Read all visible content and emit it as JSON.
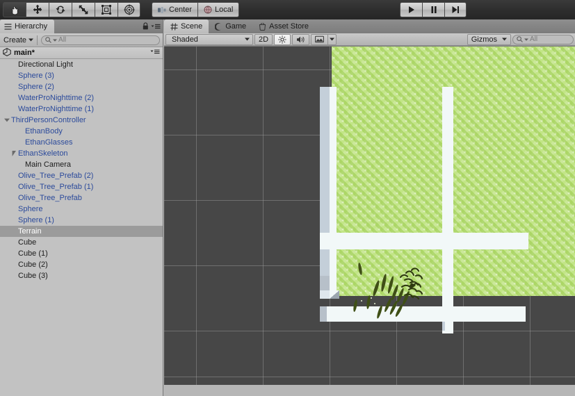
{
  "toolbar": {
    "tools": [
      {
        "name": "hand-tool",
        "icon": "hand-icon",
        "active": true
      },
      {
        "name": "move-tool",
        "icon": "move-arrows-icon",
        "active": false
      },
      {
        "name": "rotate-tool",
        "icon": "rotate-icon",
        "active": false
      },
      {
        "name": "scale-tool",
        "icon": "scale-icon",
        "active": false
      },
      {
        "name": "rect-tool",
        "icon": "rect-transform-icon",
        "active": false
      },
      {
        "name": "transform-tool",
        "icon": "combined-transform-icon",
        "active": false
      }
    ],
    "pivot_label": "Center",
    "pivot_icon": "pivot-center-icon",
    "space_label": "Local",
    "space_icon": "local-space-icon",
    "play_label": "play-icon",
    "pause_label": "pause-icon",
    "step_label": "step-icon"
  },
  "hierarchy": {
    "tab_label": "Hierarchy",
    "tab_icon": "hierarchy-icon",
    "lock_icon": "lock-icon",
    "menu_icon": "panel-menu-icon",
    "create_label": "Create",
    "search_placeholder": "All",
    "search_value": "",
    "scene_name": "main*",
    "items": [
      {
        "label": "Directional Light",
        "prefab": false,
        "indent": 1,
        "twisty": "none",
        "selected": false
      },
      {
        "label": "Sphere (3)",
        "prefab": true,
        "indent": 1,
        "twisty": "none",
        "selected": false
      },
      {
        "label": "Sphere (2)",
        "prefab": true,
        "indent": 1,
        "twisty": "none",
        "selected": false
      },
      {
        "label": "WaterProNighttime (2)",
        "prefab": true,
        "indent": 1,
        "twisty": "none",
        "selected": false
      },
      {
        "label": "WaterProNighttime (1)",
        "prefab": true,
        "indent": 1,
        "twisty": "none",
        "selected": false
      },
      {
        "label": "ThirdPersonController",
        "prefab": true,
        "indent": 0,
        "twisty": "open",
        "selected": false
      },
      {
        "label": "EthanBody",
        "prefab": true,
        "indent": 2,
        "twisty": "none",
        "selected": false
      },
      {
        "label": "EthanGlasses",
        "prefab": true,
        "indent": 2,
        "twisty": "none",
        "selected": false
      },
      {
        "label": "EthanSkeleton",
        "prefab": true,
        "indent": 1,
        "twisty": "closed",
        "selected": false
      },
      {
        "label": "Main Camera",
        "prefab": false,
        "indent": 2,
        "twisty": "none",
        "selected": false
      },
      {
        "label": "Olive_Tree_Prefab (2)",
        "prefab": true,
        "indent": 1,
        "twisty": "none",
        "selected": false
      },
      {
        "label": "Olive_Tree_Prefab (1)",
        "prefab": true,
        "indent": 1,
        "twisty": "none",
        "selected": false
      },
      {
        "label": "Olive_Tree_Prefab",
        "prefab": true,
        "indent": 1,
        "twisty": "none",
        "selected": false
      },
      {
        "label": "Sphere",
        "prefab": true,
        "indent": 1,
        "twisty": "none",
        "selected": false
      },
      {
        "label": "Sphere (1)",
        "prefab": true,
        "indent": 1,
        "twisty": "none",
        "selected": false
      },
      {
        "label": "Terrain",
        "prefab": false,
        "indent": 1,
        "twisty": "none",
        "selected": true
      },
      {
        "label": "Cube",
        "prefab": false,
        "indent": 1,
        "twisty": "none",
        "selected": false
      },
      {
        "label": "Cube (1)",
        "prefab": false,
        "indent": 1,
        "twisty": "none",
        "selected": false
      },
      {
        "label": "Cube (2)",
        "prefab": false,
        "indent": 1,
        "twisty": "none",
        "selected": false
      },
      {
        "label": "Cube (3)",
        "prefab": false,
        "indent": 1,
        "twisty": "none",
        "selected": false
      }
    ]
  },
  "scene_panel": {
    "tabs": [
      {
        "label": "Scene",
        "icon": "scene-grid-icon",
        "active": true
      },
      {
        "label": "Game",
        "icon": "game-pad-icon",
        "active": false
      },
      {
        "label": "Asset Store",
        "icon": "asset-store-icon",
        "active": false
      }
    ],
    "draw_mode": "Shaded",
    "mode_2d_label": "2D",
    "lighting_icon": "sun-icon",
    "audio_icon": "speaker-icon",
    "effects_icon": "image-effects-icon",
    "effects_dropdown_icon": "chevron-down-icon",
    "gizmos_label": "Gizmos",
    "search_placeholder": "All",
    "search_value": ""
  },
  "colors": {
    "viewport_background": "#474747",
    "grid_line": "#a0a0a0",
    "terrain_green": "#cbe89a",
    "geometry_white": "#f2f8f8",
    "geometry_side": "#c4cfd9",
    "panel_gray": "#c2c2c2",
    "selection_highlight": "#9b9b9b",
    "prefab_blue": "#2b4a9b"
  }
}
